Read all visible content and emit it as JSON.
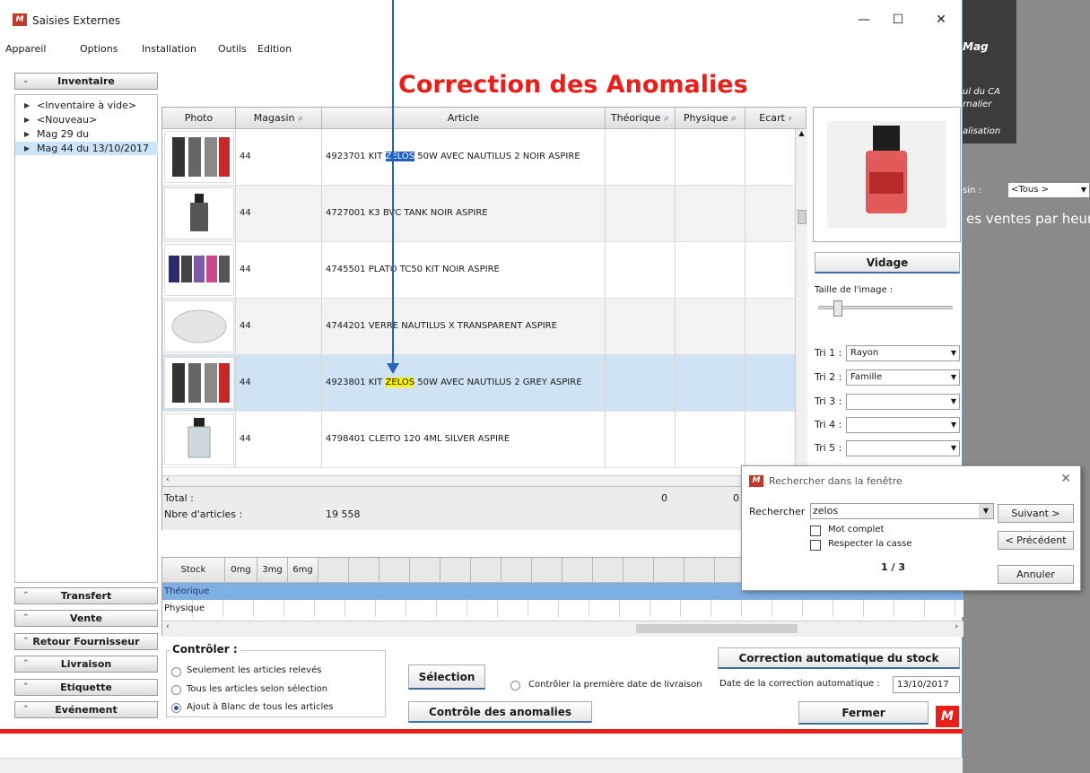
{
  "window": {
    "title": "Saisies Externes",
    "min": "—",
    "max": "☐",
    "close": "✕"
  },
  "menu": [
    "Appareil",
    "Options",
    "Installation",
    "Outils",
    "Edition"
  ],
  "left_panel": {
    "top_button": "Inventaire",
    "tree": [
      "<Inventaire à vide>",
      "<Nouveau>",
      "Mag 29 du",
      "Mag 44 du 13/10/2017"
    ],
    "bottom_buttons": [
      "Transfert",
      "Vente",
      "Retour Fournisseur",
      "Livraison",
      "Etiquette",
      "Evénement"
    ]
  },
  "headline": "Correction des Anomalies",
  "grid": {
    "columns": [
      "Photo",
      "Magasin",
      "Article",
      "Théorique",
      "Physique",
      "Ecart"
    ],
    "rows": [
      {
        "magasin": "44",
        "pre": "4923701 KIT ",
        "hl": "ZELOS",
        "post": " 50W AVEC NAUTILUS 2 NOIR ASPIRE"
      },
      {
        "magasin": "44",
        "pre": "4727001 K3 BVC TANK NOIR ASPIRE",
        "hl": "",
        "post": ""
      },
      {
        "magasin": "44",
        "pre": "4745501 PLATO TC50 KIT NOIR ASPIRE",
        "hl": "",
        "post": ""
      },
      {
        "magasin": "44",
        "pre": "4744201 VERRE NAUTILUS X TRANSPARENT ASPIRE",
        "hl": "",
        "post": ""
      },
      {
        "magasin": "44",
        "pre": "4923801 KIT ",
        "hl": "ZELOS",
        "post": " 50W AVEC NAUTILUS 2 GREY ASPIRE"
      },
      {
        "magasin": "44",
        "pre": "4798401 CLEITO 120 4ML SILVER ASPIRE",
        "hl": "",
        "post": ""
      }
    ],
    "total_label": "Total :",
    "count_label": "Nbre d'articles :",
    "count_value": "19 558",
    "total_theorique": "0",
    "total_physique": "0"
  },
  "stock_grid": {
    "columns": [
      "Stock",
      "0mg",
      "3mg",
      "6mg"
    ],
    "rows": [
      "Théorique",
      "Physique"
    ]
  },
  "right_panel": {
    "vidage": "Vidage",
    "image_size_label": "Taille de l'image :",
    "tri": [
      {
        "label": "Tri 1 :",
        "value": "Rayon"
      },
      {
        "label": "Tri 2 :",
        "value": "Famille"
      },
      {
        "label": "Tri 3 :",
        "value": ""
      },
      {
        "label": "Tri 4 :",
        "value": ""
      },
      {
        "label": "Tri 5 :",
        "value": ""
      }
    ]
  },
  "controls": {
    "legend": "Contrôler :",
    "radios": [
      "Seulement les articles relevés",
      "Tous les articles selon sélection",
      "Ajout à Blanc de tous les articles"
    ],
    "selection": "Sélection",
    "controle": "Contrôle des anomalies",
    "first_date": "Contrôler la première date de livraison",
    "correction_auto": "Correction automatique du stock",
    "date_label": "Date de la correction automatique :",
    "date_value": "13/10/2017",
    "fermer": "Fermer"
  },
  "dialog": {
    "title": "Rechercher dans la fenêtre",
    "search_label": "Rechercher",
    "search_value": "zelos",
    "whole_word": "Mot complet",
    "match_case": "Respecter la casse",
    "counter": "1 / 3",
    "next": "Suivant >",
    "prev": "< Précédent",
    "cancel": "Annuler"
  },
  "background_app": {
    "title": "Mag",
    "line1": "ul du CA",
    "line2": "rnalier",
    "line3": "alisation",
    "sel_label": "sin :",
    "sel_value": "<Tous >",
    "big_text": "es ventes par heure"
  },
  "colors": {
    "accent": "#e8201c",
    "selection": "#cfe3f5",
    "link_blue": "#2a62b5"
  }
}
